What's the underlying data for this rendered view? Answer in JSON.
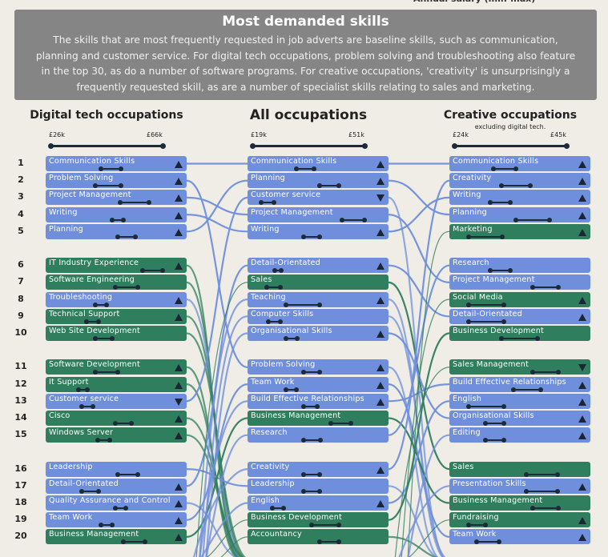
{
  "top_note": "Annual salary (min-max)",
  "banner": {
    "title": "Most demanded skills",
    "text": "The skills that are most frequently requested in job adverts are baseline skills, such as communication, planning and customer service. For digital tech occupations, problem solving and troubleshooting also feature in the top 30, as do a number of software programs. For creative occupations, 'creativity' is unsurprisingly a frequently requested skill, as are a number of specialist skills relating to sales and marketing."
  },
  "colors": {
    "baseline": "#6f8fdc",
    "specialist": "#2f7e5e",
    "background": "#efede5",
    "banner": "#858585"
  },
  "ranks": [
    1,
    2,
    3,
    4,
    5,
    6,
    7,
    8,
    9,
    10,
    11,
    12,
    13,
    14,
    15,
    16,
    17,
    18,
    19,
    20
  ],
  "columns": [
    {
      "key": "digital",
      "title": "Digital tech occupations",
      "subtitle": "",
      "scale_min": "£26k",
      "scale_max": "£66k",
      "items": [
        {
          "label": "Communication Skills",
          "type": "baseline",
          "trend": "up",
          "range": [
            0.45,
            0.63
          ]
        },
        {
          "label": "Problem Solving",
          "type": "baseline",
          "trend": "up",
          "range": [
            0.4,
            0.63
          ]
        },
        {
          "label": "Project Management",
          "type": "baseline",
          "trend": "up",
          "range": [
            0.62,
            0.88
          ]
        },
        {
          "label": "Writing",
          "type": "baseline",
          "trend": "up",
          "range": [
            0.55,
            0.65
          ]
        },
        {
          "label": "Planning",
          "type": "baseline",
          "trend": "up",
          "range": [
            0.6,
            0.76
          ]
        },
        {
          "label": "IT Industry Experience",
          "type": "specialist",
          "trend": "up",
          "range": [
            0.82,
            1.0
          ]
        },
        {
          "label": "Software Engineering",
          "type": "specialist",
          "trend": "none",
          "range": [
            0.58,
            0.78
          ]
        },
        {
          "label": "Troubleshooting",
          "type": "baseline",
          "trend": "up",
          "range": [
            0.4,
            0.5
          ]
        },
        {
          "label": "Technical Support",
          "type": "specialist",
          "trend": "up",
          "range": [
            0.32,
            0.43
          ]
        },
        {
          "label": "Web Site Development",
          "type": "specialist",
          "trend": "none",
          "range": [
            0.4,
            0.55
          ]
        },
        {
          "label": "Software Development",
          "type": "specialist",
          "trend": "up",
          "range": [
            0.4,
            0.6
          ]
        },
        {
          "label": "It Support",
          "type": "specialist",
          "trend": "up",
          "range": [
            0.25,
            0.33
          ]
        },
        {
          "label": "Customer service",
          "type": "baseline",
          "trend": "down",
          "range": [
            0.28,
            0.38
          ]
        },
        {
          "label": "Cisco",
          "type": "specialist",
          "trend": "up",
          "range": [
            0.58,
            0.72
          ]
        },
        {
          "label": "Windows Server",
          "type": "specialist",
          "trend": "up",
          "range": [
            0.42,
            0.53
          ]
        },
        {
          "label": "Leadership",
          "type": "baseline",
          "trend": "none",
          "range": [
            0.6,
            0.78
          ]
        },
        {
          "label": "Detail-Orientated",
          "type": "baseline",
          "trend": "up",
          "range": [
            0.28,
            0.43
          ]
        },
        {
          "label": "Quality Assurance and Control",
          "type": "baseline",
          "trend": "up",
          "range": [
            0.58,
            0.67
          ]
        },
        {
          "label": "Team Work",
          "type": "baseline",
          "trend": "up",
          "range": [
            0.45,
            0.55
          ]
        },
        {
          "label": "Business Management",
          "type": "specialist",
          "trend": "up",
          "range": [
            0.65,
            0.84
          ]
        }
      ]
    },
    {
      "key": "all",
      "title": "All occupations",
      "subtitle": "",
      "scale_min": "£19k",
      "scale_max": "£51k",
      "items": [
        {
          "label": "Communication Skills",
          "type": "baseline",
          "trend": "up",
          "range": [
            0.39,
            0.55
          ]
        },
        {
          "label": "Planning",
          "type": "baseline",
          "trend": "up",
          "range": [
            0.6,
            0.77
          ]
        },
        {
          "label": "Customer service",
          "type": "baseline",
          "trend": "down",
          "range": [
            0.08,
            0.19
          ]
        },
        {
          "label": "Project Management",
          "type": "baseline",
          "trend": "none",
          "range": [
            0.8,
            1.0
          ]
        },
        {
          "label": "Writing",
          "type": "baseline",
          "trend": "up",
          "range": [
            0.46,
            0.6
          ]
        },
        {
          "label": "Detail-Orientated",
          "type": "baseline",
          "trend": "up",
          "range": [
            0.2,
            0.26
          ]
        },
        {
          "label": "Sales",
          "type": "specialist",
          "trend": "none",
          "range": [
            0.13,
            0.25
          ]
        },
        {
          "label": "Teaching",
          "type": "baseline",
          "trend": "up",
          "range": [
            0.3,
            0.6
          ]
        },
        {
          "label": "Computer Skills",
          "type": "baseline",
          "trend": "none",
          "range": [
            0.14,
            0.25
          ]
        },
        {
          "label": "Organisational Skills",
          "type": "baseline",
          "trend": "up",
          "range": [
            0.3,
            0.4
          ]
        },
        {
          "label": "Problem Solving",
          "type": "baseline",
          "trend": "up",
          "range": [
            0.46,
            0.6
          ]
        },
        {
          "label": "Team Work",
          "type": "baseline",
          "trend": "up",
          "range": [
            0.3,
            0.39
          ]
        },
        {
          "label": "Build Effective Relationships",
          "type": "baseline",
          "trend": "up",
          "range": [
            0.46,
            0.58
          ]
        },
        {
          "label": "Business Management",
          "type": "specialist",
          "trend": "none",
          "range": [
            0.7,
            0.88
          ]
        },
        {
          "label": "Research",
          "type": "baseline",
          "trend": "none",
          "range": [
            0.46,
            0.61
          ]
        },
        {
          "label": "Creativity",
          "type": "baseline",
          "trend": "up",
          "range": [
            0.46,
            0.6
          ]
        },
        {
          "label": "Leadership",
          "type": "baseline",
          "trend": "none",
          "range": [
            0.46,
            0.6
          ]
        },
        {
          "label": "English",
          "type": "baseline",
          "trend": "up",
          "range": [
            0.18,
            0.28
          ]
        },
        {
          "label": "Business Development",
          "type": "specialist",
          "trend": "none",
          "range": [
            0.53,
            0.77
          ]
        },
        {
          "label": "Accountancy",
          "type": "specialist",
          "trend": "none",
          "range": [
            0.6,
            0.77
          ]
        }
      ]
    },
    {
      "key": "creative",
      "title": "Creative occupations",
      "subtitle": "excluding digital tech.",
      "scale_min": "£24k",
      "scale_max": "£45k",
      "items": [
        {
          "label": "Communication Skills",
          "type": "baseline",
          "trend": "up",
          "range": [
            0.35,
            0.55
          ]
        },
        {
          "label": "Creativity",
          "type": "baseline",
          "trend": "up",
          "range": [
            0.42,
            0.68
          ]
        },
        {
          "label": "Writing",
          "type": "baseline",
          "trend": "up",
          "range": [
            0.32,
            0.5
          ]
        },
        {
          "label": "Planning",
          "type": "baseline",
          "trend": "up",
          "range": [
            0.55,
            0.85
          ]
        },
        {
          "label": "Marketing",
          "type": "specialist",
          "trend": "up",
          "range": [
            0.13,
            0.43
          ]
        },
        {
          "label": "Research",
          "type": "baseline",
          "trend": "none",
          "range": [
            0.32,
            0.5
          ]
        },
        {
          "label": "Project Management",
          "type": "baseline",
          "trend": "none",
          "range": [
            0.7,
            0.93
          ]
        },
        {
          "label": "Social Media",
          "type": "specialist",
          "trend": "up",
          "range": [
            0.13,
            0.44
          ]
        },
        {
          "label": "Detail-Orientated",
          "type": "baseline",
          "trend": "up",
          "range": [
            0.13,
            0.44
          ]
        },
        {
          "label": "Business Development",
          "type": "specialist",
          "trend": "none",
          "range": [
            0.42,
            0.74
          ]
        },
        {
          "label": "Sales Management",
          "type": "specialist",
          "trend": "down",
          "range": [
            0.7,
            0.93
          ]
        },
        {
          "label": "Build Effective Relationships",
          "type": "baseline",
          "trend": "up",
          "range": [
            0.53,
            0.77
          ]
        },
        {
          "label": "English",
          "type": "baseline",
          "trend": "up",
          "range": [
            0.13,
            0.44
          ]
        },
        {
          "label": "Organisational Skills",
          "type": "baseline",
          "trend": "up",
          "range": [
            0.28,
            0.44
          ]
        },
        {
          "label": "Editing",
          "type": "baseline",
          "trend": "up",
          "range": [
            0.28,
            0.44
          ]
        },
        {
          "label": "Sales",
          "type": "specialist",
          "trend": "none",
          "range": [
            0.64,
            0.92
          ]
        },
        {
          "label": "Presentation Skills",
          "type": "baseline",
          "trend": "up",
          "range": [
            0.64,
            0.92
          ]
        },
        {
          "label": "Business Management",
          "type": "specialist",
          "trend": "none",
          "range": [
            0.7,
            0.93
          ]
        },
        {
          "label": "Fundraising",
          "type": "specialist",
          "trend": "up",
          "range": [
            0.13,
            0.28
          ]
        },
        {
          "label": "Team Work",
          "type": "baseline",
          "trend": "up",
          "range": [
            0.2,
            0.4
          ]
        }
      ]
    }
  ]
}
